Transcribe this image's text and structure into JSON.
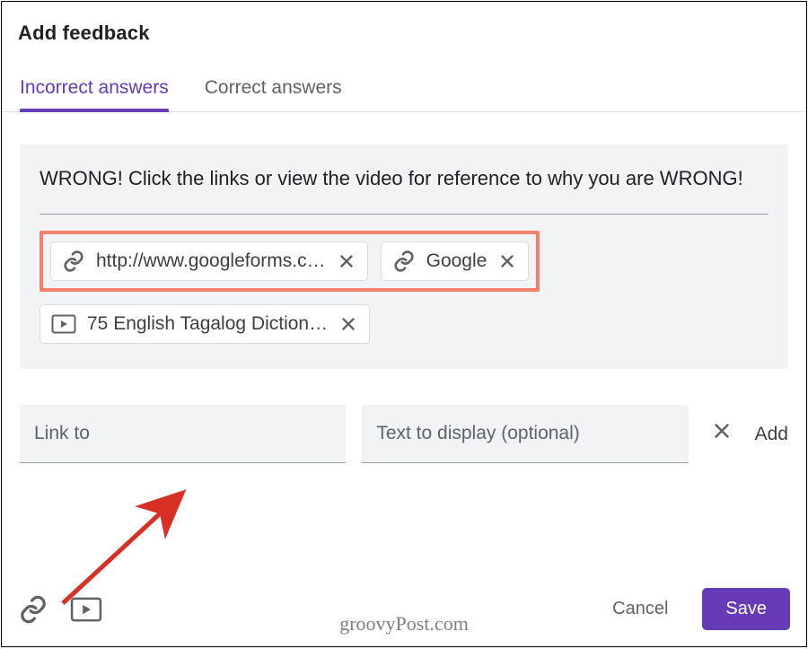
{
  "dialog": {
    "title": "Add feedback",
    "tabs": [
      {
        "label": "Incorrect answers",
        "active": true
      },
      {
        "label": "Correct answers",
        "active": false
      }
    ],
    "feedback_text": "WRONG! Click the links or view the video for reference to why you are WRONG!",
    "link_chips": [
      {
        "type": "link",
        "label": "http://www.googleforms.c…"
      },
      {
        "type": "link",
        "label": "Google"
      }
    ],
    "video_chips": [
      {
        "type": "video",
        "label": "75 English Tagalog Diction…"
      }
    ],
    "add_link": {
      "link_to_placeholder": "Link to",
      "text_display_placeholder": "Text to display (optional)",
      "add_label": "Add"
    },
    "footer": {
      "cancel_label": "Cancel",
      "save_label": "Save"
    }
  },
  "watermark": "groovyPost.com",
  "colors": {
    "accent": "#673ab7",
    "highlight_box": "#f77f6e",
    "surface": "#f1f3f4",
    "text_secondary": "#5f6368"
  }
}
